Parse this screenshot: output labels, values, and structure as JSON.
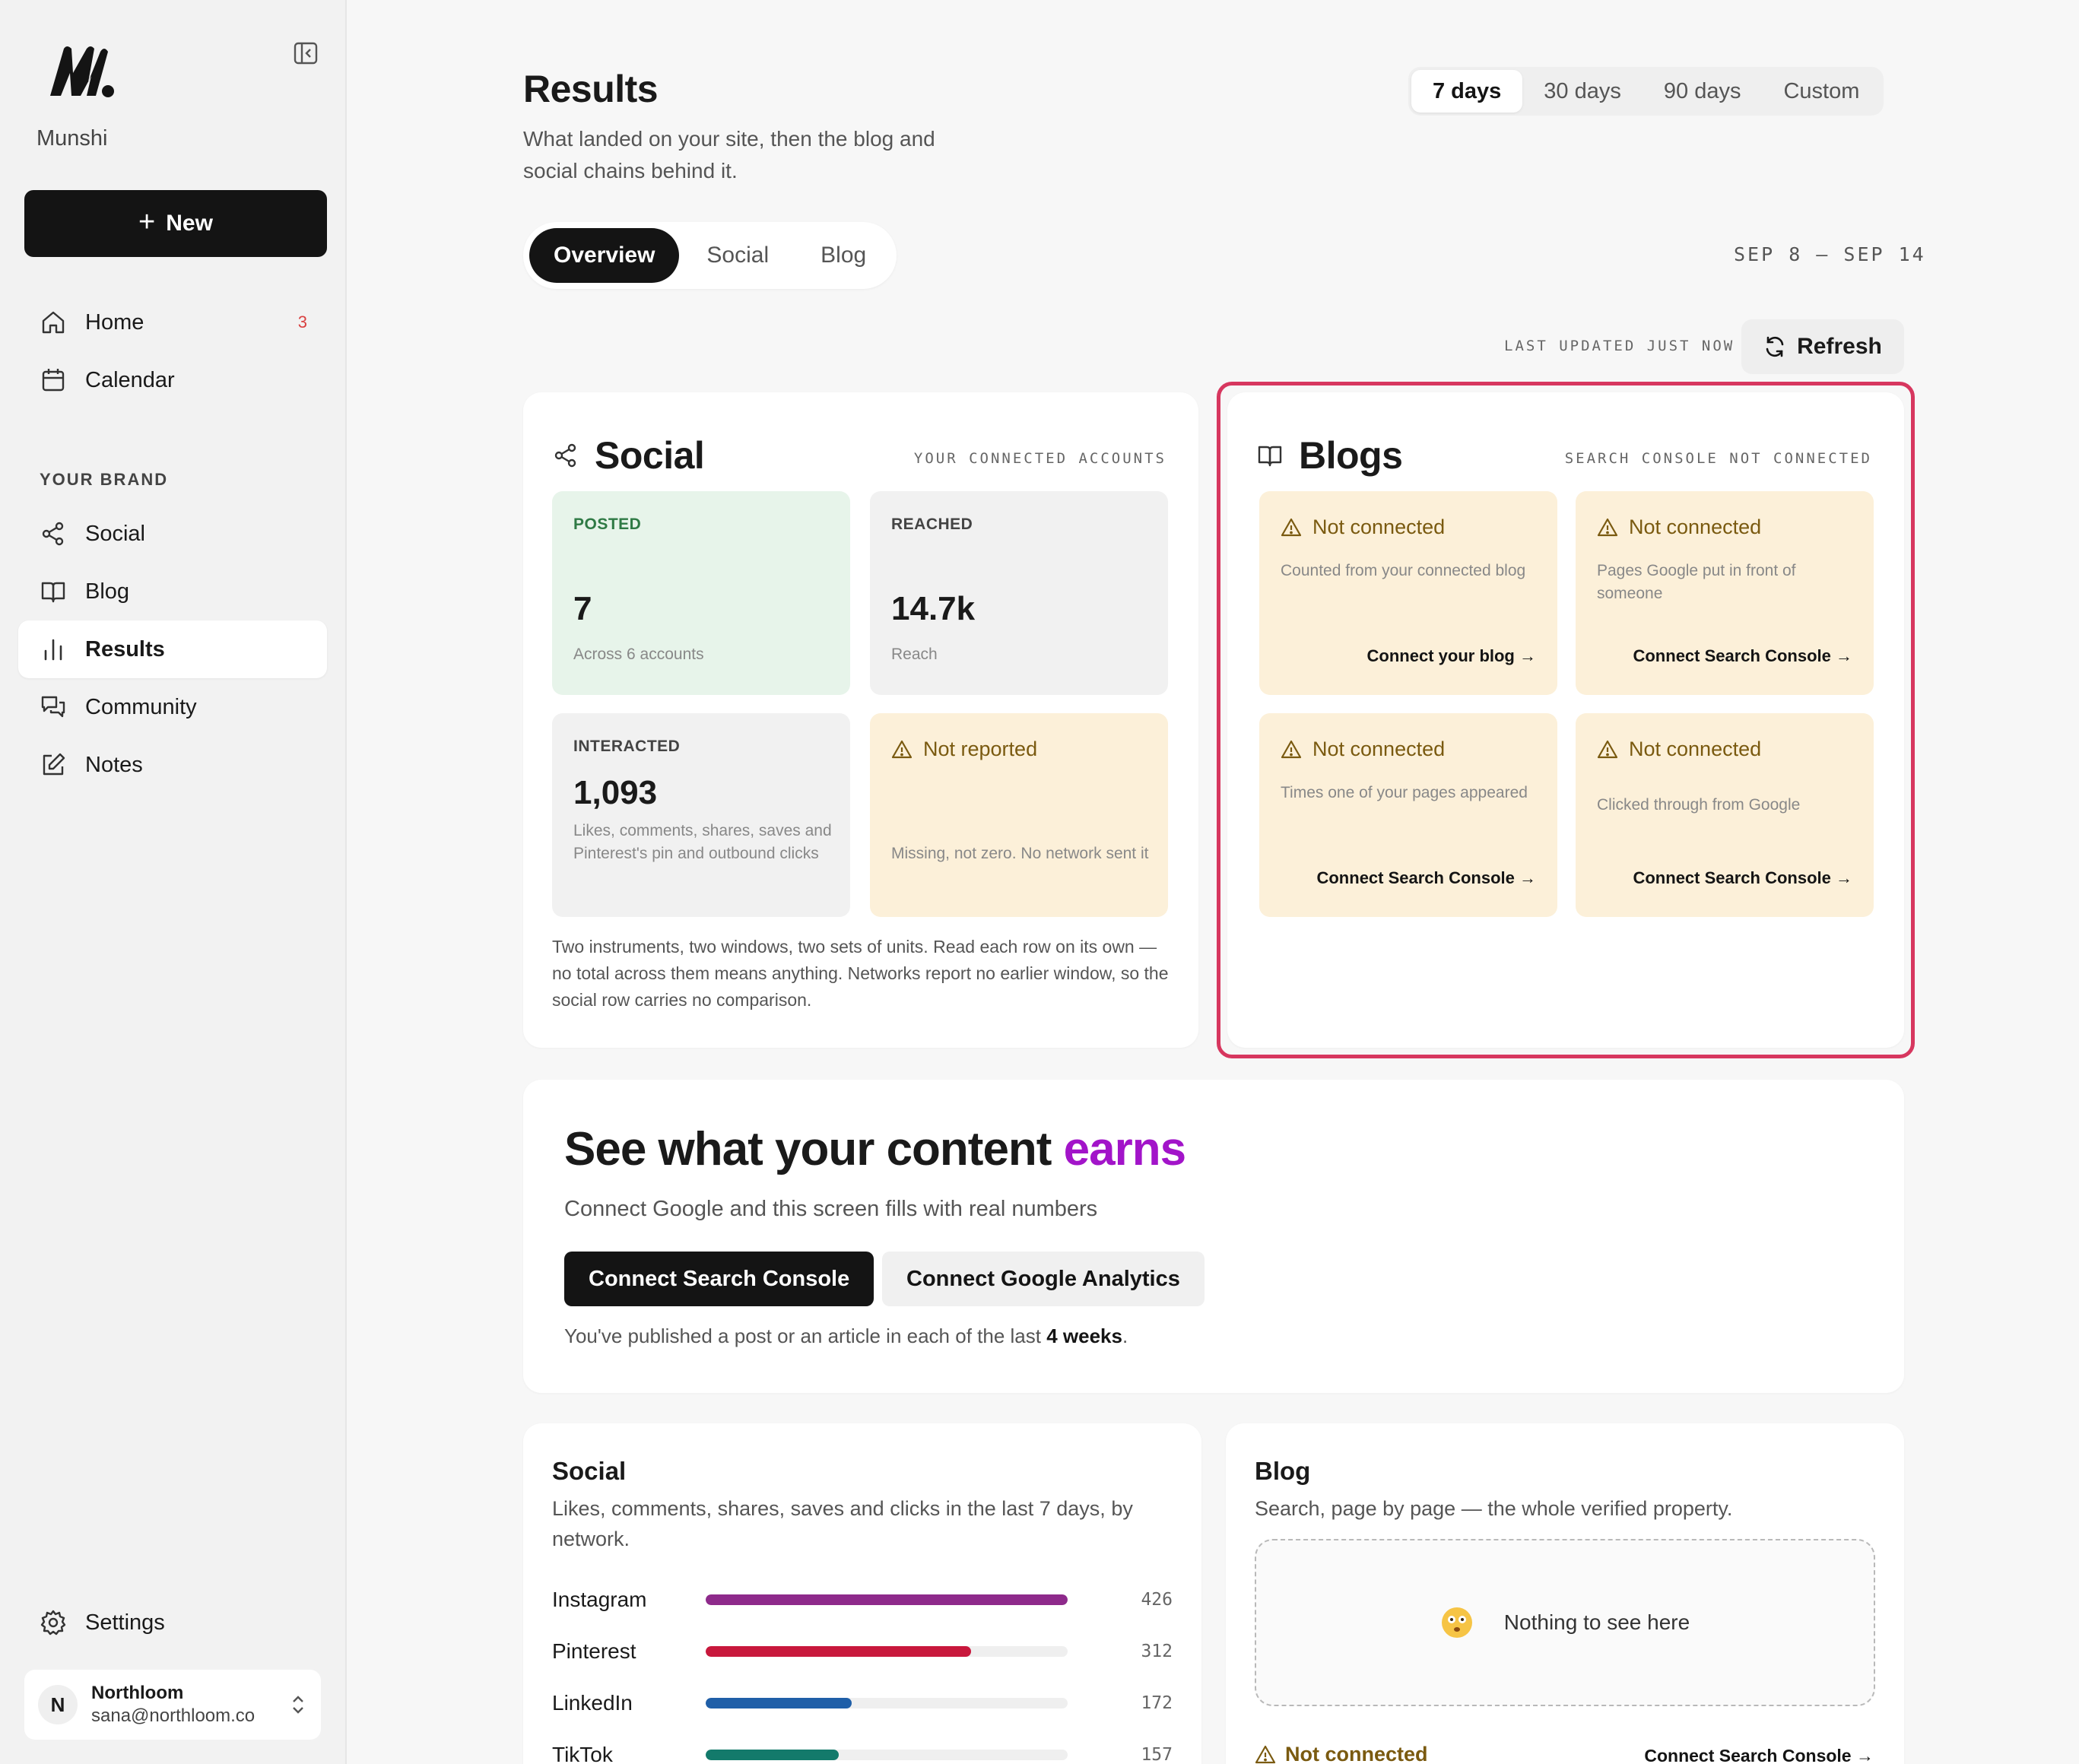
{
  "app": {
    "brand_name": "Munshi"
  },
  "sidebar": {
    "new_label": "New",
    "nav": [
      {
        "label": "Home",
        "icon": "home-icon",
        "badge": "3"
      },
      {
        "label": "Calendar",
        "icon": "calendar-icon"
      }
    ],
    "section_label": "YOUR BRAND",
    "brand_nav": [
      {
        "label": "Social",
        "icon": "share-icon"
      },
      {
        "label": "Blog",
        "icon": "book-icon"
      },
      {
        "label": "Results",
        "icon": "bar-chart-icon",
        "active": true
      },
      {
        "label": "Community",
        "icon": "chat-icon"
      },
      {
        "label": "Notes",
        "icon": "edit-icon"
      }
    ],
    "settings_label": "Settings",
    "account": {
      "initial": "N",
      "name": "Northloom",
      "email": "sana@northloom.co"
    }
  },
  "header": {
    "title": "Results",
    "subtitle": "What landed on your site, then the blog and social chains behind it.",
    "ranges": [
      "7 days",
      "30 days",
      "90 days",
      "Custom"
    ],
    "active_range": "7 days",
    "tabs": [
      "Overview",
      "Social",
      "Blog"
    ],
    "active_tab": "Overview",
    "date_range": "SEP 8 – SEP 14",
    "last_updated": "LAST UPDATED JUST NOW",
    "refresh_label": "Refresh"
  },
  "social_card": {
    "title": "Social",
    "meta": "YOUR CONNECTED ACCOUNTS",
    "posted": {
      "label": "POSTED",
      "value": "7",
      "desc": "Across 6 accounts"
    },
    "reached": {
      "label": "REACHED",
      "value": "14.7k",
      "desc": "Reach"
    },
    "interacted": {
      "label": "INTERACTED",
      "value": "1,093",
      "desc": "Likes, comments, shares, saves and Pinterest's pin and outbound clicks"
    },
    "not_reported": {
      "label": "Not reported",
      "desc": "Missing, not zero. No network sent it"
    },
    "note": "Two instruments, two windows, two sets of units. Read each row on its own — no total across them means anything. Networks report no earlier window, so the social row carries no comparison."
  },
  "blogs_card": {
    "title": "Blogs",
    "meta": "SEARCH CONSOLE NOT CONNECTED",
    "tiles": [
      {
        "label": "Not connected",
        "desc": "Counted from your connected blog",
        "link": "Connect your blog →"
      },
      {
        "label": "Not connected",
        "desc": "Pages Google put in front of someone",
        "link": "Connect Search Console →"
      },
      {
        "label": "Not connected",
        "desc": "Times one of your pages appeared",
        "link": "Connect Search Console →"
      },
      {
        "label": "Not connected",
        "desc": "Clicked through from Google",
        "link": "Connect Search Console →"
      }
    ]
  },
  "cta": {
    "title_start": "See what your content ",
    "title_accent": "earns",
    "subtitle": "Connect Google and this screen fills with real numbers",
    "primary_label": "Connect Search Console",
    "secondary_label": "Connect Google Analytics",
    "foot_start": "You've published a post or an article in each of the last ",
    "foot_bold": "4 weeks",
    "foot_end": "."
  },
  "social_breakdown": {
    "title": "Social",
    "desc": "Likes, comments, shares, saves and clicks in the last 7 days, by network.",
    "max": 426,
    "rows": [
      {
        "name": "Instagram",
        "value": 426,
        "label": "426",
        "color": "#8e2a8b"
      },
      {
        "name": "Pinterest",
        "value": 312,
        "label": "312",
        "color": "#c8183c"
      },
      {
        "name": "LinkedIn",
        "value": 172,
        "label": "172",
        "color": "#1f5fa8"
      },
      {
        "name": "TikTok",
        "value": 157,
        "label": "157",
        "color": "#137a6b"
      }
    ]
  },
  "blog_breakdown": {
    "title": "Blog",
    "desc": "Search, page by page — the whole verified property.",
    "empty_text": "Nothing to see here",
    "warn_label": "Not connected",
    "link": "Connect Search Console →"
  },
  "colors": {
    "accent": "#a214c9",
    "highlight": "#d7375f",
    "warn_bg": "#fcf0d9",
    "posted_bg": "#e7f4ea"
  }
}
